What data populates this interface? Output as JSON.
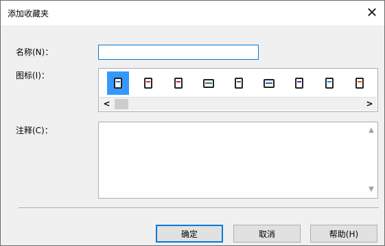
{
  "dialog": {
    "title": "添加收藏夹",
    "close_glyph": "✕"
  },
  "form": {
    "name_label": "名称(N)：",
    "name_value": "",
    "icon_label": "图标(I)：",
    "comment_label": "注释(C)：",
    "comment_value": ""
  },
  "icons": [
    {
      "name": "book-blue-icon",
      "selected": true,
      "color": "#2b6fd6"
    },
    {
      "name": "book-red-icon",
      "selected": false,
      "color": "#d22a2a"
    },
    {
      "name": "book-slash-icon",
      "selected": false,
      "color": "#c2185b"
    },
    {
      "name": "picture-icon",
      "selected": false,
      "color": "#2e7d32"
    },
    {
      "name": "book-plain-icon",
      "selected": false,
      "color": "#555555"
    },
    {
      "name": "open-book-icon",
      "selected": false,
      "color": "#1565c0"
    },
    {
      "name": "book-pen-icon",
      "selected": false,
      "color": "#6a1b9a"
    },
    {
      "name": "photo-book-icon",
      "selected": false,
      "color": "#1e88e5"
    },
    {
      "name": "book-orange-icon",
      "selected": false,
      "color": "#e65100"
    }
  ],
  "scroll": {
    "left_arrow": "<",
    "right_arrow": ">"
  },
  "buttons": {
    "ok": "确定",
    "cancel": "取消",
    "help": "帮助(H)"
  }
}
